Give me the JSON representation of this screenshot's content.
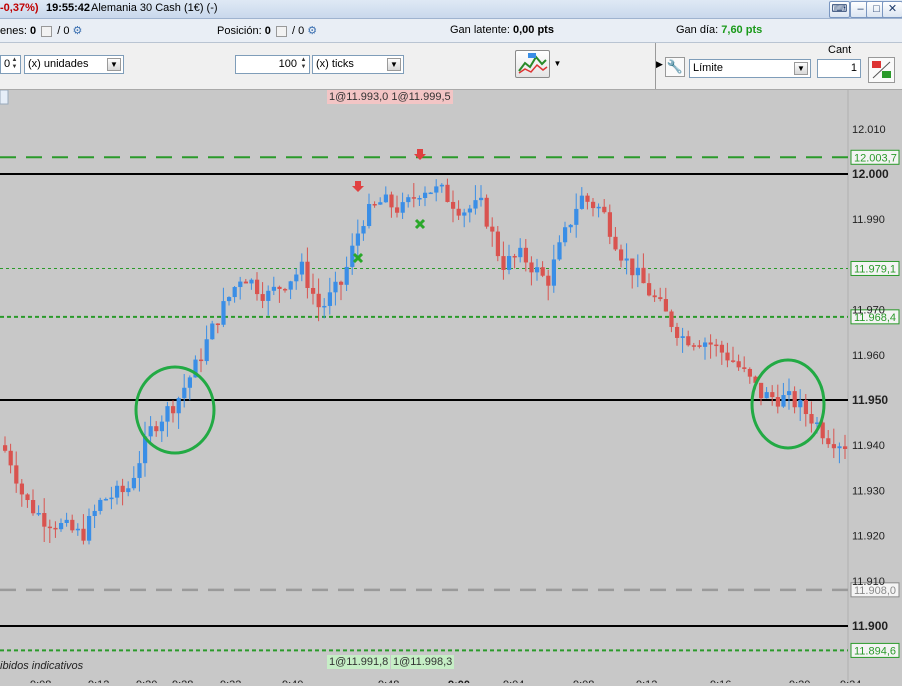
{
  "titlebar": {
    "change": "-0,37%)",
    "time": "19:55:42",
    "instrument": "Alemania 30 Cash (1€) (-)"
  },
  "infobar": {
    "orders_label": "enes:",
    "orders_count": "0",
    "orders_sep": "/ 0",
    "position_label": "Posición:",
    "position_count": "0",
    "position_sep": "/ 0",
    "latent_label": "Gan latente:",
    "latent_value": "0,00 pts",
    "day_label": "Gan día:",
    "day_value": "7,60 pts"
  },
  "toolbar": {
    "qty_value": "0",
    "units_select": "(x) unidades",
    "ticks_value": "100",
    "ticks_select": "(x) ticks",
    "cant_label": "Cant",
    "order_type": "Límite",
    "cant_value": "1"
  },
  "chart": {
    "top_marker": "1@11.993,0 1@11.999,5",
    "bottom_marker_left": "1@11.991,8",
    "bottom_marker_right": "1@11.998,3",
    "footer_note": "ibidos indicativos",
    "price_ticks": [
      {
        "label": "12.010",
        "bold": false
      },
      {
        "label": "12.000",
        "bold": true
      },
      {
        "label": "11.990",
        "bold": false
      },
      {
        "label": "11.970",
        "bold": false
      },
      {
        "label": "11.960",
        "bold": false
      },
      {
        "label": "11.950",
        "bold": true
      },
      {
        "label": "11.940",
        "bold": false
      },
      {
        "label": "11.930",
        "bold": false
      },
      {
        "label": "11.920",
        "bold": false
      },
      {
        "label": "11.910",
        "bold": false
      },
      {
        "label": "11.900",
        "bold": true
      }
    ],
    "level_tags": [
      {
        "label": "12.003,7",
        "color": "#2a9a2a"
      },
      {
        "label": "11.979,1",
        "color": "#2a9a2a"
      },
      {
        "label": "11.968,4",
        "color": "#2a9a2a"
      },
      {
        "label": "11.908,0",
        "color": "#8a8a8a"
      },
      {
        "label": "11.894,6",
        "color": "#2a9a2a"
      }
    ],
    "time_labels": [
      "9:08",
      "9:12",
      "9:20",
      "9:28",
      "9:32",
      "9:40",
      "9:48",
      "9:00",
      "9:04",
      "9:08",
      "9:12",
      "9:16",
      "9:20",
      "9:24"
    ],
    "colors": {
      "up": "#3a8ee6",
      "down": "#d9534f",
      "circle": "#22aa44",
      "dash_green": "#2a9a2a"
    }
  }
}
